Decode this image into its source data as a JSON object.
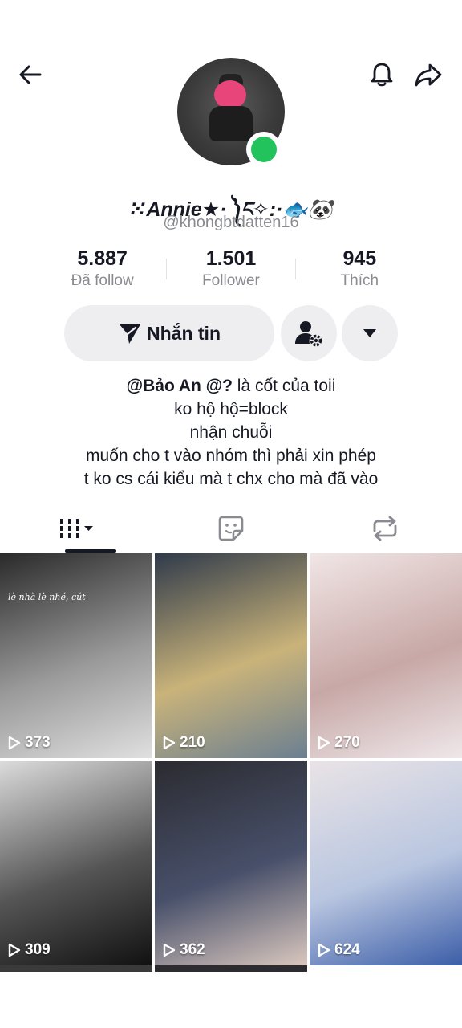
{
  "header": {
    "back_icon": "arrow-left-icon",
    "notification_icon": "bell-icon",
    "share_icon": "share-arrow-icon"
  },
  "profile": {
    "display_name": "⁙Annie★·༽ང✧:·🐟🐼",
    "username": "@khongbtdatten16",
    "online_color": "#22c35d"
  },
  "stats": [
    {
      "value": "5.887",
      "label": "Đã follow"
    },
    {
      "value": "1.501",
      "label": "Follower"
    },
    {
      "value": "945",
      "label": "Thích"
    }
  ],
  "actions": {
    "message_label": "Nhắn tin",
    "message_icon": "send-icon",
    "add_friend_icon": "user-settings-icon",
    "dropdown_icon": "caret-down-icon"
  },
  "bio": {
    "mention": "@Bảo An @?",
    "line1_rest": " là cốt của toii",
    "line2": "ko hộ hộ=block",
    "line3": "nhận chuỗi",
    "line4": "muốn cho t vào nhóm thì phải xin phép",
    "line5": "t ko cs cái kiểu mà t chx cho mà đã vào"
  },
  "tabs": [
    {
      "name": "videos",
      "icon": "grid-bars-icon"
    },
    {
      "name": "favorites",
      "icon": "sticker-icon"
    },
    {
      "name": "reposts",
      "icon": "repost-icon"
    }
  ],
  "videos": [
    {
      "views": "373",
      "caption": "lè nhà lè nhé, cút",
      "palette": [
        "#2a2a2a",
        "#9a9a9a",
        "#e0e0e0"
      ]
    },
    {
      "views": "210",
      "caption": "",
      "palette": [
        "#2f3a4a",
        "#c9b37a",
        "#6b7f91"
      ]
    },
    {
      "views": "270",
      "caption": "",
      "palette": [
        "#f1e6e6",
        "#c7a8a6",
        "#efe7ea"
      ]
    },
    {
      "views": "309",
      "caption": "",
      "palette": [
        "#dcdcdc",
        "#555555",
        "#111111"
      ]
    },
    {
      "views": "362",
      "caption": "",
      "palette": [
        "#2b2b30",
        "#48506a",
        "#d9c7be"
      ]
    },
    {
      "views": "624",
      "caption": "",
      "palette": [
        "#e9e3e6",
        "#b9c6e0",
        "#3c5ea8"
      ]
    }
  ]
}
